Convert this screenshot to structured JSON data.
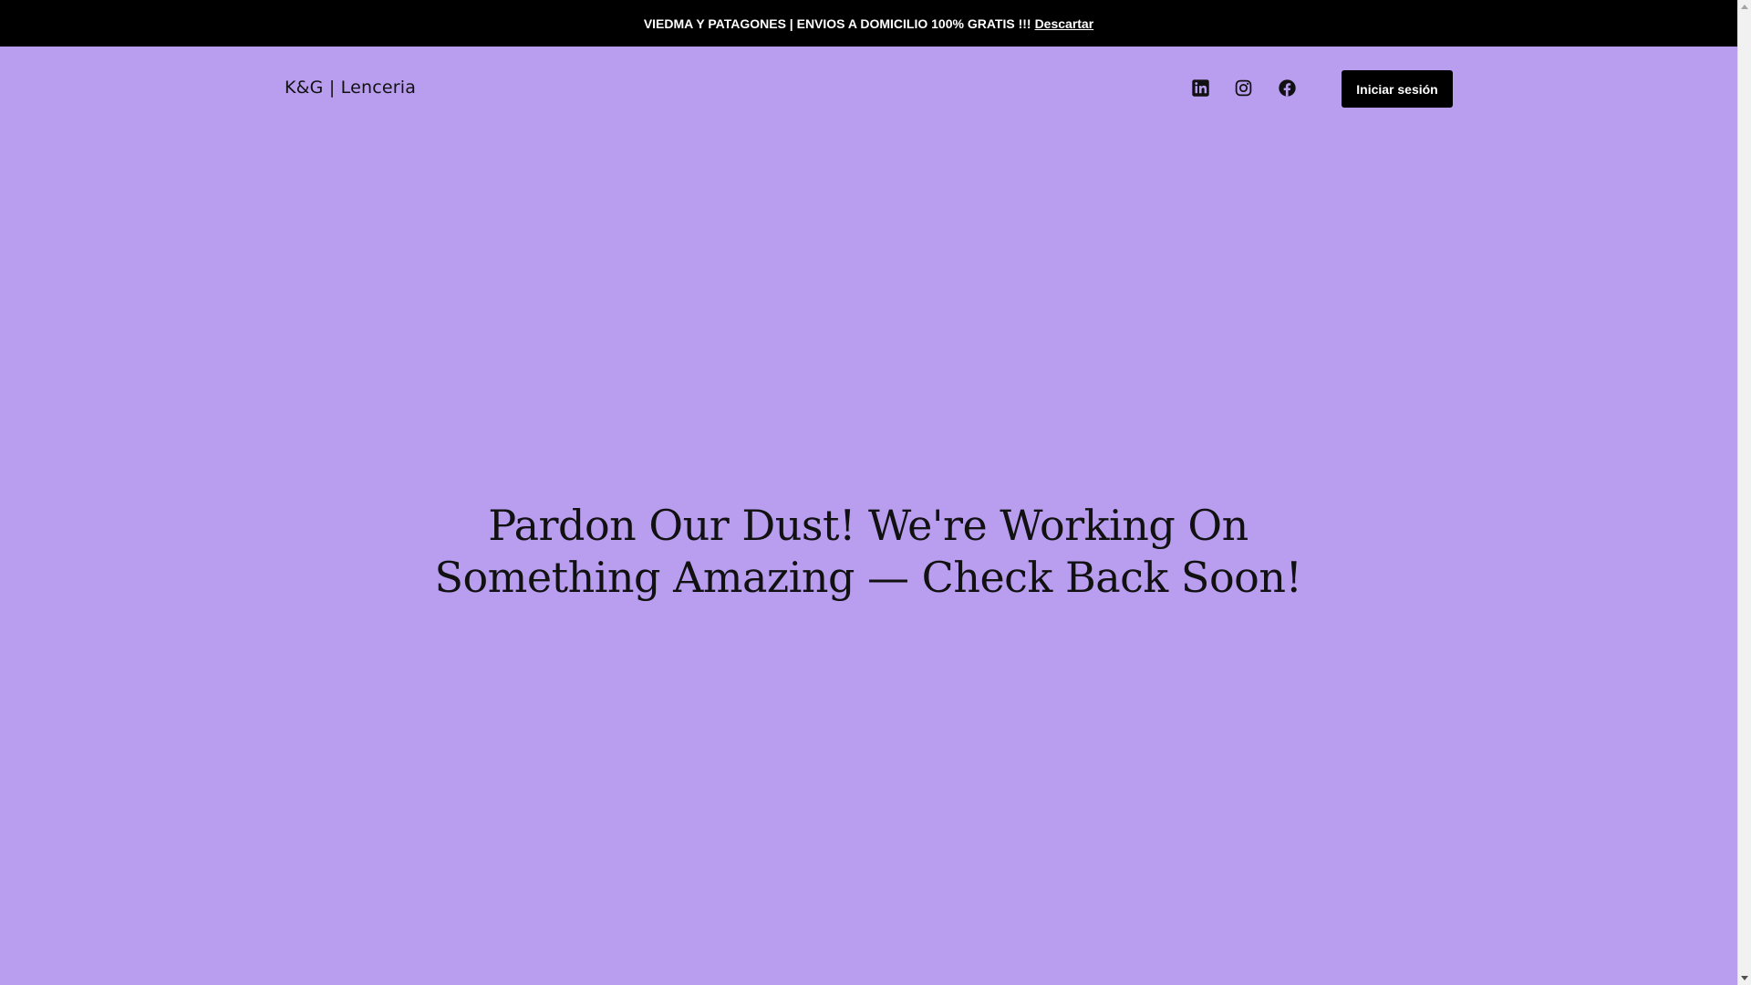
{
  "banner": {
    "message": "VIEDMA Y PATAGONES | ENVIOS A DOMICILIO 100% GRATIS !!!",
    "dismiss_label": "Descartar"
  },
  "header": {
    "brand": "K&G | Lenceria",
    "social_icons": [
      "linkedin-icon",
      "instagram-icon",
      "facebook-icon"
    ],
    "login_label": "Iniciar sesión"
  },
  "main": {
    "title": "Pardon Our Dust! We're Working On Something Amazing — Check Back Soon!"
  },
  "colors": {
    "background": "#b99ef0",
    "banner_bg": "#000000",
    "text": "#111111",
    "button_bg": "#000000",
    "button_text": "#ffffff"
  }
}
